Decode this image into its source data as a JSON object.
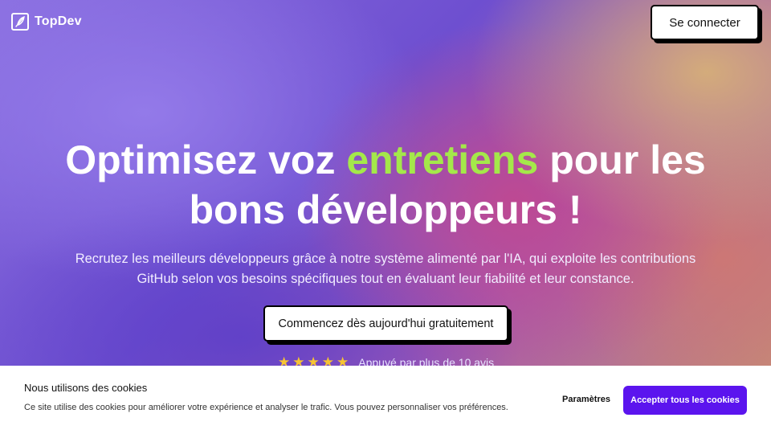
{
  "brand": {
    "name": "TopDev",
    "logo_icon": "feather-icon"
  },
  "header": {
    "login_label": "Se connecter"
  },
  "hero": {
    "headline_part1": "Optimisez voz ",
    "headline_accent": "entretiens",
    "headline_part2": " pour les bons développeurs !",
    "accent_color": "#a4e84a",
    "subtitle": "Recrutez les meilleurs développeurs grâce à notre système alimenté par l'IA, qui exploite les contributions GitHub selon vos besoins spécifiques tout en évaluant leur fiabilité et leur constance.",
    "cta_label": "Commencez dès aujourd'hui gratuitement",
    "rating": {
      "stars": 5,
      "text": "Appuyé par plus de 10 avis"
    }
  },
  "cookie_banner": {
    "title": "Nous utilisons des cookies",
    "text": "Ce site utilise des cookies pour améliorer votre expérience et analyser le trafic. Vous pouvez personnaliser vos préférences.",
    "settings_label": "Paramètres",
    "accept_label": "Accepter tous les cookies",
    "accept_color": "#5b14ee"
  }
}
